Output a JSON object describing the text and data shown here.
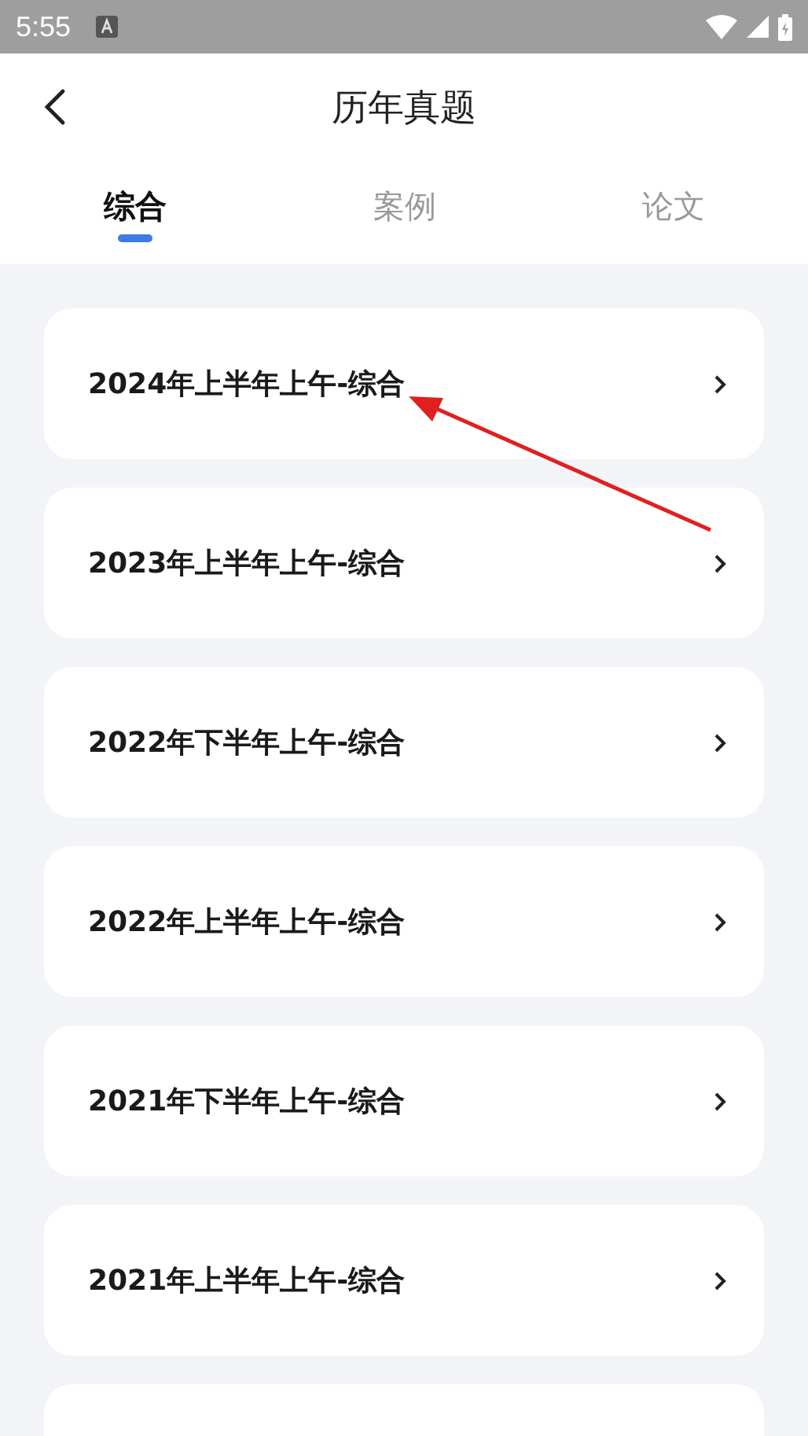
{
  "status_bar": {
    "time": "5:55"
  },
  "header": {
    "title": "历年真题"
  },
  "tabs": [
    {
      "label": "综合",
      "selected": true
    },
    {
      "label": "案例",
      "selected": false
    },
    {
      "label": "论文",
      "selected": false
    }
  ],
  "items": [
    {
      "kind": "row",
      "title": "2024年上半年上午-综合"
    },
    {
      "kind": "row",
      "title": "2023年上半年上午-综合"
    },
    {
      "kind": "row",
      "title": "2022年下半年上午-综合"
    },
    {
      "kind": "row",
      "title": "2022年上半年上午-综合"
    },
    {
      "kind": "row",
      "title": "2021年下半年上午-综合"
    },
    {
      "kind": "row",
      "title": "2021年上半年上午-综合"
    },
    {
      "kind": "partial"
    }
  ]
}
